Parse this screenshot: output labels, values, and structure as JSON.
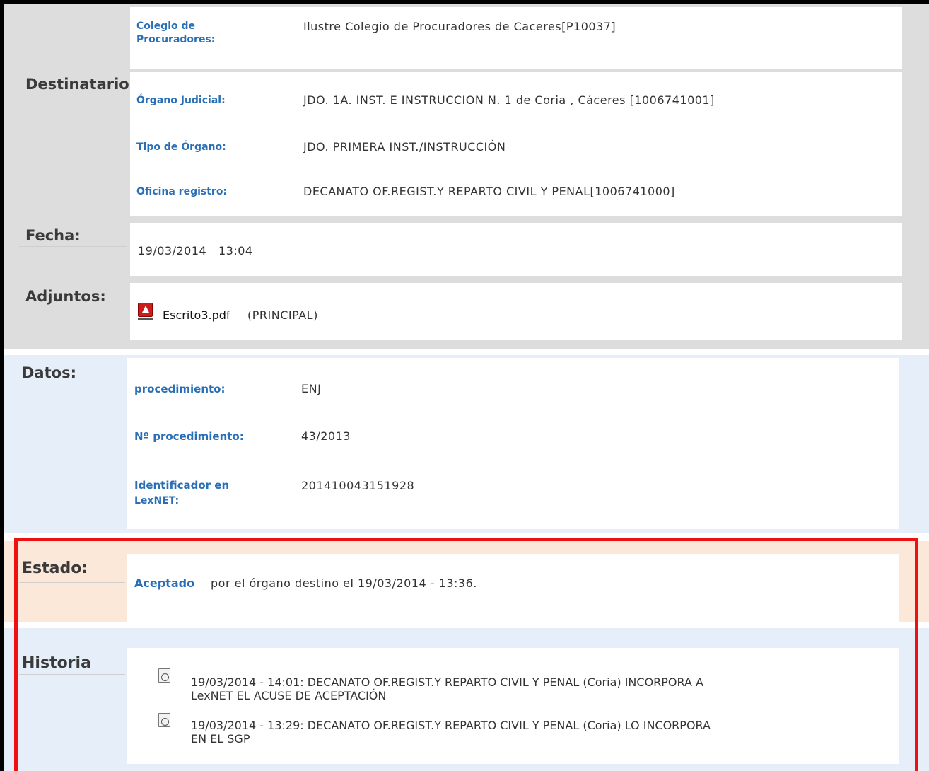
{
  "destinatario": {
    "label": "Destinatario",
    "colegio_label": "Colegio de Procuradores:",
    "colegio_value": "Ilustre Colegio de Procuradores de Caceres[P10037]",
    "organo_label": "Órgano Judicial:",
    "organo_value": "JDO. 1A. INST. E INSTRUCCION N. 1 de Coria , Cáceres [1006741001]",
    "tipo_label": "Tipo de Órgano:",
    "tipo_value": "JDO. PRIMERA INST./INSTRUCCIÓN",
    "oficina_label": "Oficina registro:",
    "oficina_value": "DECANATO OF.REGIST.Y REPARTO CIVIL Y PENAL[1006741000]"
  },
  "fecha": {
    "label": "Fecha:",
    "value": "19/03/2014   13:04"
  },
  "adjuntos": {
    "label": "Adjuntos:",
    "file_name": "Escrito3.pdf",
    "file_type": "(PRINCIPAL)",
    "icon": "pdf-icon"
  },
  "datos": {
    "label": "Datos:",
    "procedimiento_label": "procedimiento:",
    "procedimiento_value": "ENJ",
    "num_label": "Nº procedimiento:",
    "num_value": "43/2013",
    "ident_label_1": "Identificador en",
    "ident_label_2": "LexNET:",
    "ident_value": "201410043151928"
  },
  "estado": {
    "label": "Estado:",
    "status_word": "Aceptado",
    "status_rest": "por el órgano destino el 19/03/2014 - 13:36."
  },
  "historia": {
    "label": "Historia",
    "items": [
      {
        "line1": "19/03/2014 - 14:01: DECANATO OF.REGIST.Y REPARTO CIVIL Y PENAL (Coria) INCORPORA A",
        "line2": "LexNET EL ACUSE DE ACEPTACIÓN",
        "icon": "history-icon"
      },
      {
        "line1": "19/03/2014 - 13:29: DECANATO OF.REGIST.Y REPARTO CIVIL Y PENAL (Coria) LO INCORPORA",
        "line2": "EN EL SGP",
        "icon": "history-icon"
      }
    ]
  },
  "colors": {
    "label_blue": "#2a6fb5",
    "highlight_red": "#ee1111",
    "gray_bg": "#dddddd",
    "blue_bg": "#e6eef9",
    "peach_bg": "#fbe8d9"
  }
}
